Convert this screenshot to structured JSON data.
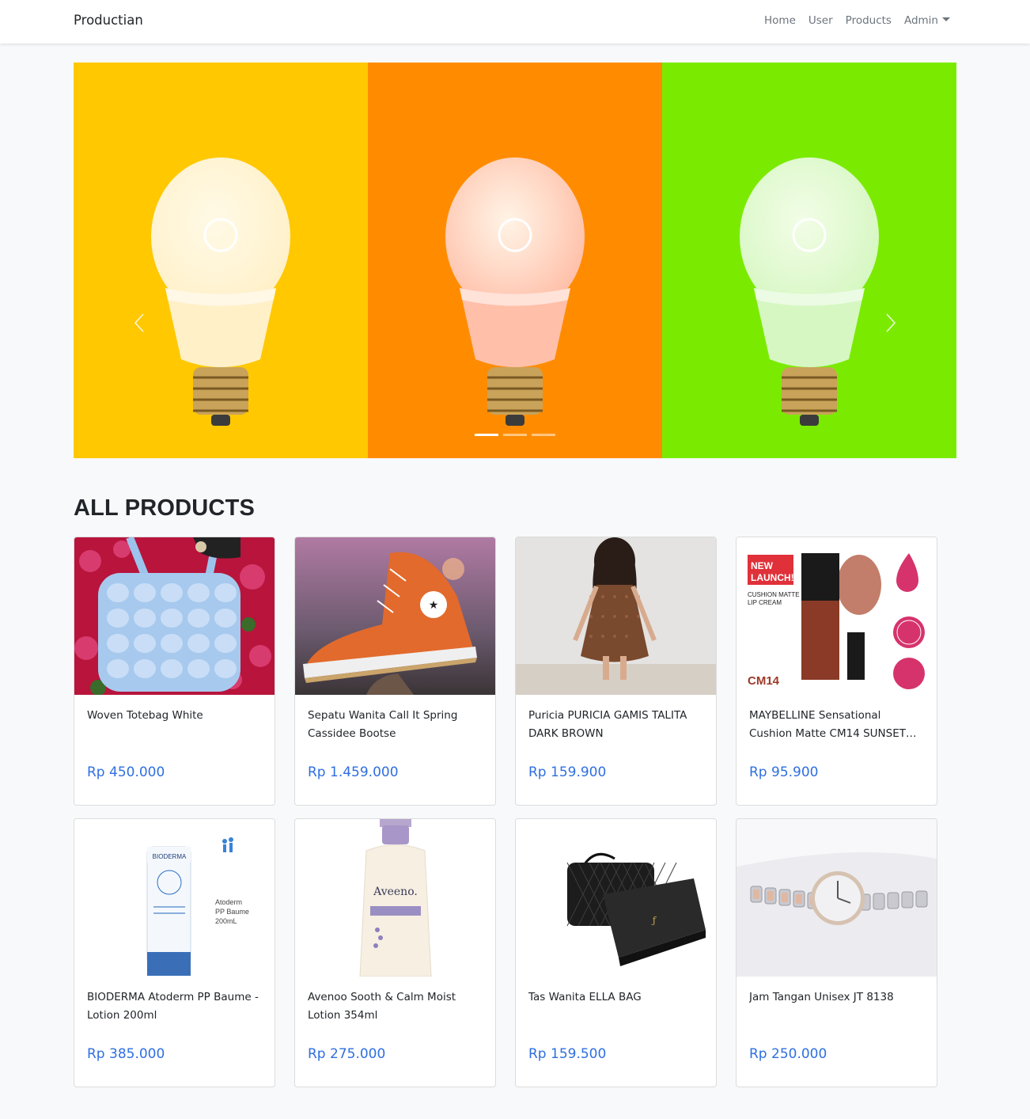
{
  "navbar": {
    "brand": "Productian",
    "links": [
      "Home",
      "User",
      "Products",
      "Admin"
    ]
  },
  "carousel": {
    "panels": [
      {
        "bg": "#ffc800",
        "bulb_tint": "#fff0c8"
      },
      {
        "bg": "#ff8c00",
        "bulb_tint": "#ffbfa8"
      },
      {
        "bg": "#7aeb00",
        "bulb_tint": "#d6f7c2"
      }
    ],
    "active_index": 0,
    "indicator_count": 3
  },
  "section": {
    "title": "ALL PRODUCTS"
  },
  "products": [
    {
      "name": "Woven Totebag White",
      "price": "Rp 450.000",
      "image": "totebag"
    },
    {
      "name": "Sepatu Wanita Call It Spring Cassidee Bootse",
      "price": "Rp 1.459.000",
      "image": "sneaker"
    },
    {
      "name": "Puricia PURICIA GAMIS TALITA DARK BROWN",
      "price": "Rp 159.900",
      "image": "dress"
    },
    {
      "name": "MAYBELLINE Sensational Cushion Matte CM14 SUNSET…",
      "price": "Rp 95.900",
      "image": "lipcream"
    },
    {
      "name": "BIODERMA Atoderm PP Baume - Lotion 200ml",
      "price": "Rp 385.000",
      "image": "lotion-tube"
    },
    {
      "name": "Avenoo Sooth & Calm Moist Lotion 354ml",
      "price": "Rp 275.000",
      "image": "lotion-bottle"
    },
    {
      "name": "Tas Wanita ELLA BAG",
      "price": "Rp 159.500",
      "image": "handbag"
    },
    {
      "name": "Jam Tangan Unisex JT 8138",
      "price": "Rp 250.000",
      "image": "watch"
    }
  ],
  "colors": {
    "price": "#2f6fe0",
    "accent_text": "#6c757d"
  }
}
